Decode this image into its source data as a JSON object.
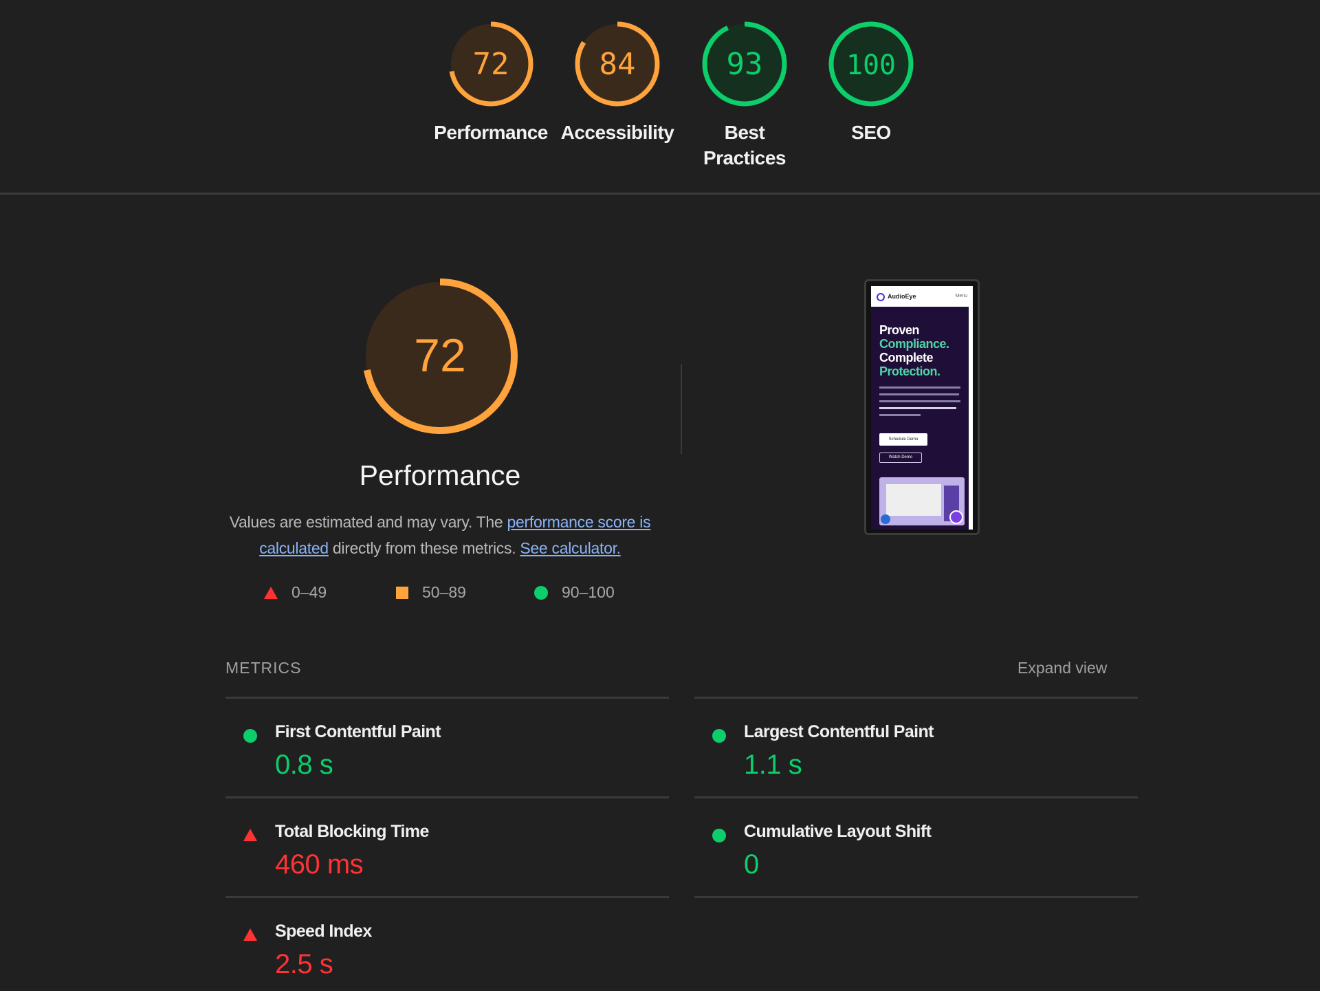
{
  "summary": [
    {
      "score": "72",
      "label": "Performance",
      "value": 72,
      "color": "#ffa33c",
      "bg": "#3a2a1c"
    },
    {
      "score": "84",
      "label": "Accessibility",
      "value": 84,
      "color": "#ffa33c",
      "bg": "#3a2a1c"
    },
    {
      "score": "93",
      "label_line1": "Best",
      "label_line2": "Practices",
      "value": 93,
      "color": "#0cce6b",
      "bg": "#16301f"
    },
    {
      "score": "100",
      "label": "SEO",
      "value": 100,
      "color": "#0cce6b",
      "bg": "#16301f"
    }
  ],
  "performance": {
    "score": "72",
    "value": 72,
    "title": "Performance",
    "desc_1": "Values are estimated and may vary. The ",
    "link_1": "performance score is calculated",
    "desc_2": " directly from these metrics. ",
    "link_2": "See calculator."
  },
  "legend": [
    {
      "range": "0–49",
      "icon": "red-triangle-icon"
    },
    {
      "range": "50–89",
      "icon": "orange-square-icon"
    },
    {
      "range": "90–100",
      "icon": "green-circle-icon"
    }
  ],
  "thumbnail": {
    "brand": "AudioEye",
    "menu": "Menu",
    "headline_1": "Proven",
    "headline_2": "Compliance.",
    "headline_3": "Complete",
    "headline_4": "Protection.",
    "button_1": "Schedule Demo",
    "button_2": "Watch Demo"
  },
  "metrics": {
    "label": "METRICS",
    "expand": "Expand view",
    "items": [
      {
        "name": "First Contentful Paint",
        "value": "0.8 s",
        "status": "good"
      },
      {
        "name": "Largest Contentful Paint",
        "value": "1.1 s",
        "status": "good"
      },
      {
        "name": "Total Blocking Time",
        "value": "460 ms",
        "status": "bad"
      },
      {
        "name": "Cumulative Layout Shift",
        "value": "0",
        "status": "good"
      },
      {
        "name": "Speed Index",
        "value": "2.5 s",
        "status": "bad"
      }
    ]
  },
  "colors": {
    "background": "#202020",
    "good": "#0cce6b",
    "average": "#ffa33c",
    "poor": "#ff3333",
    "link": "#8ab4f8"
  }
}
